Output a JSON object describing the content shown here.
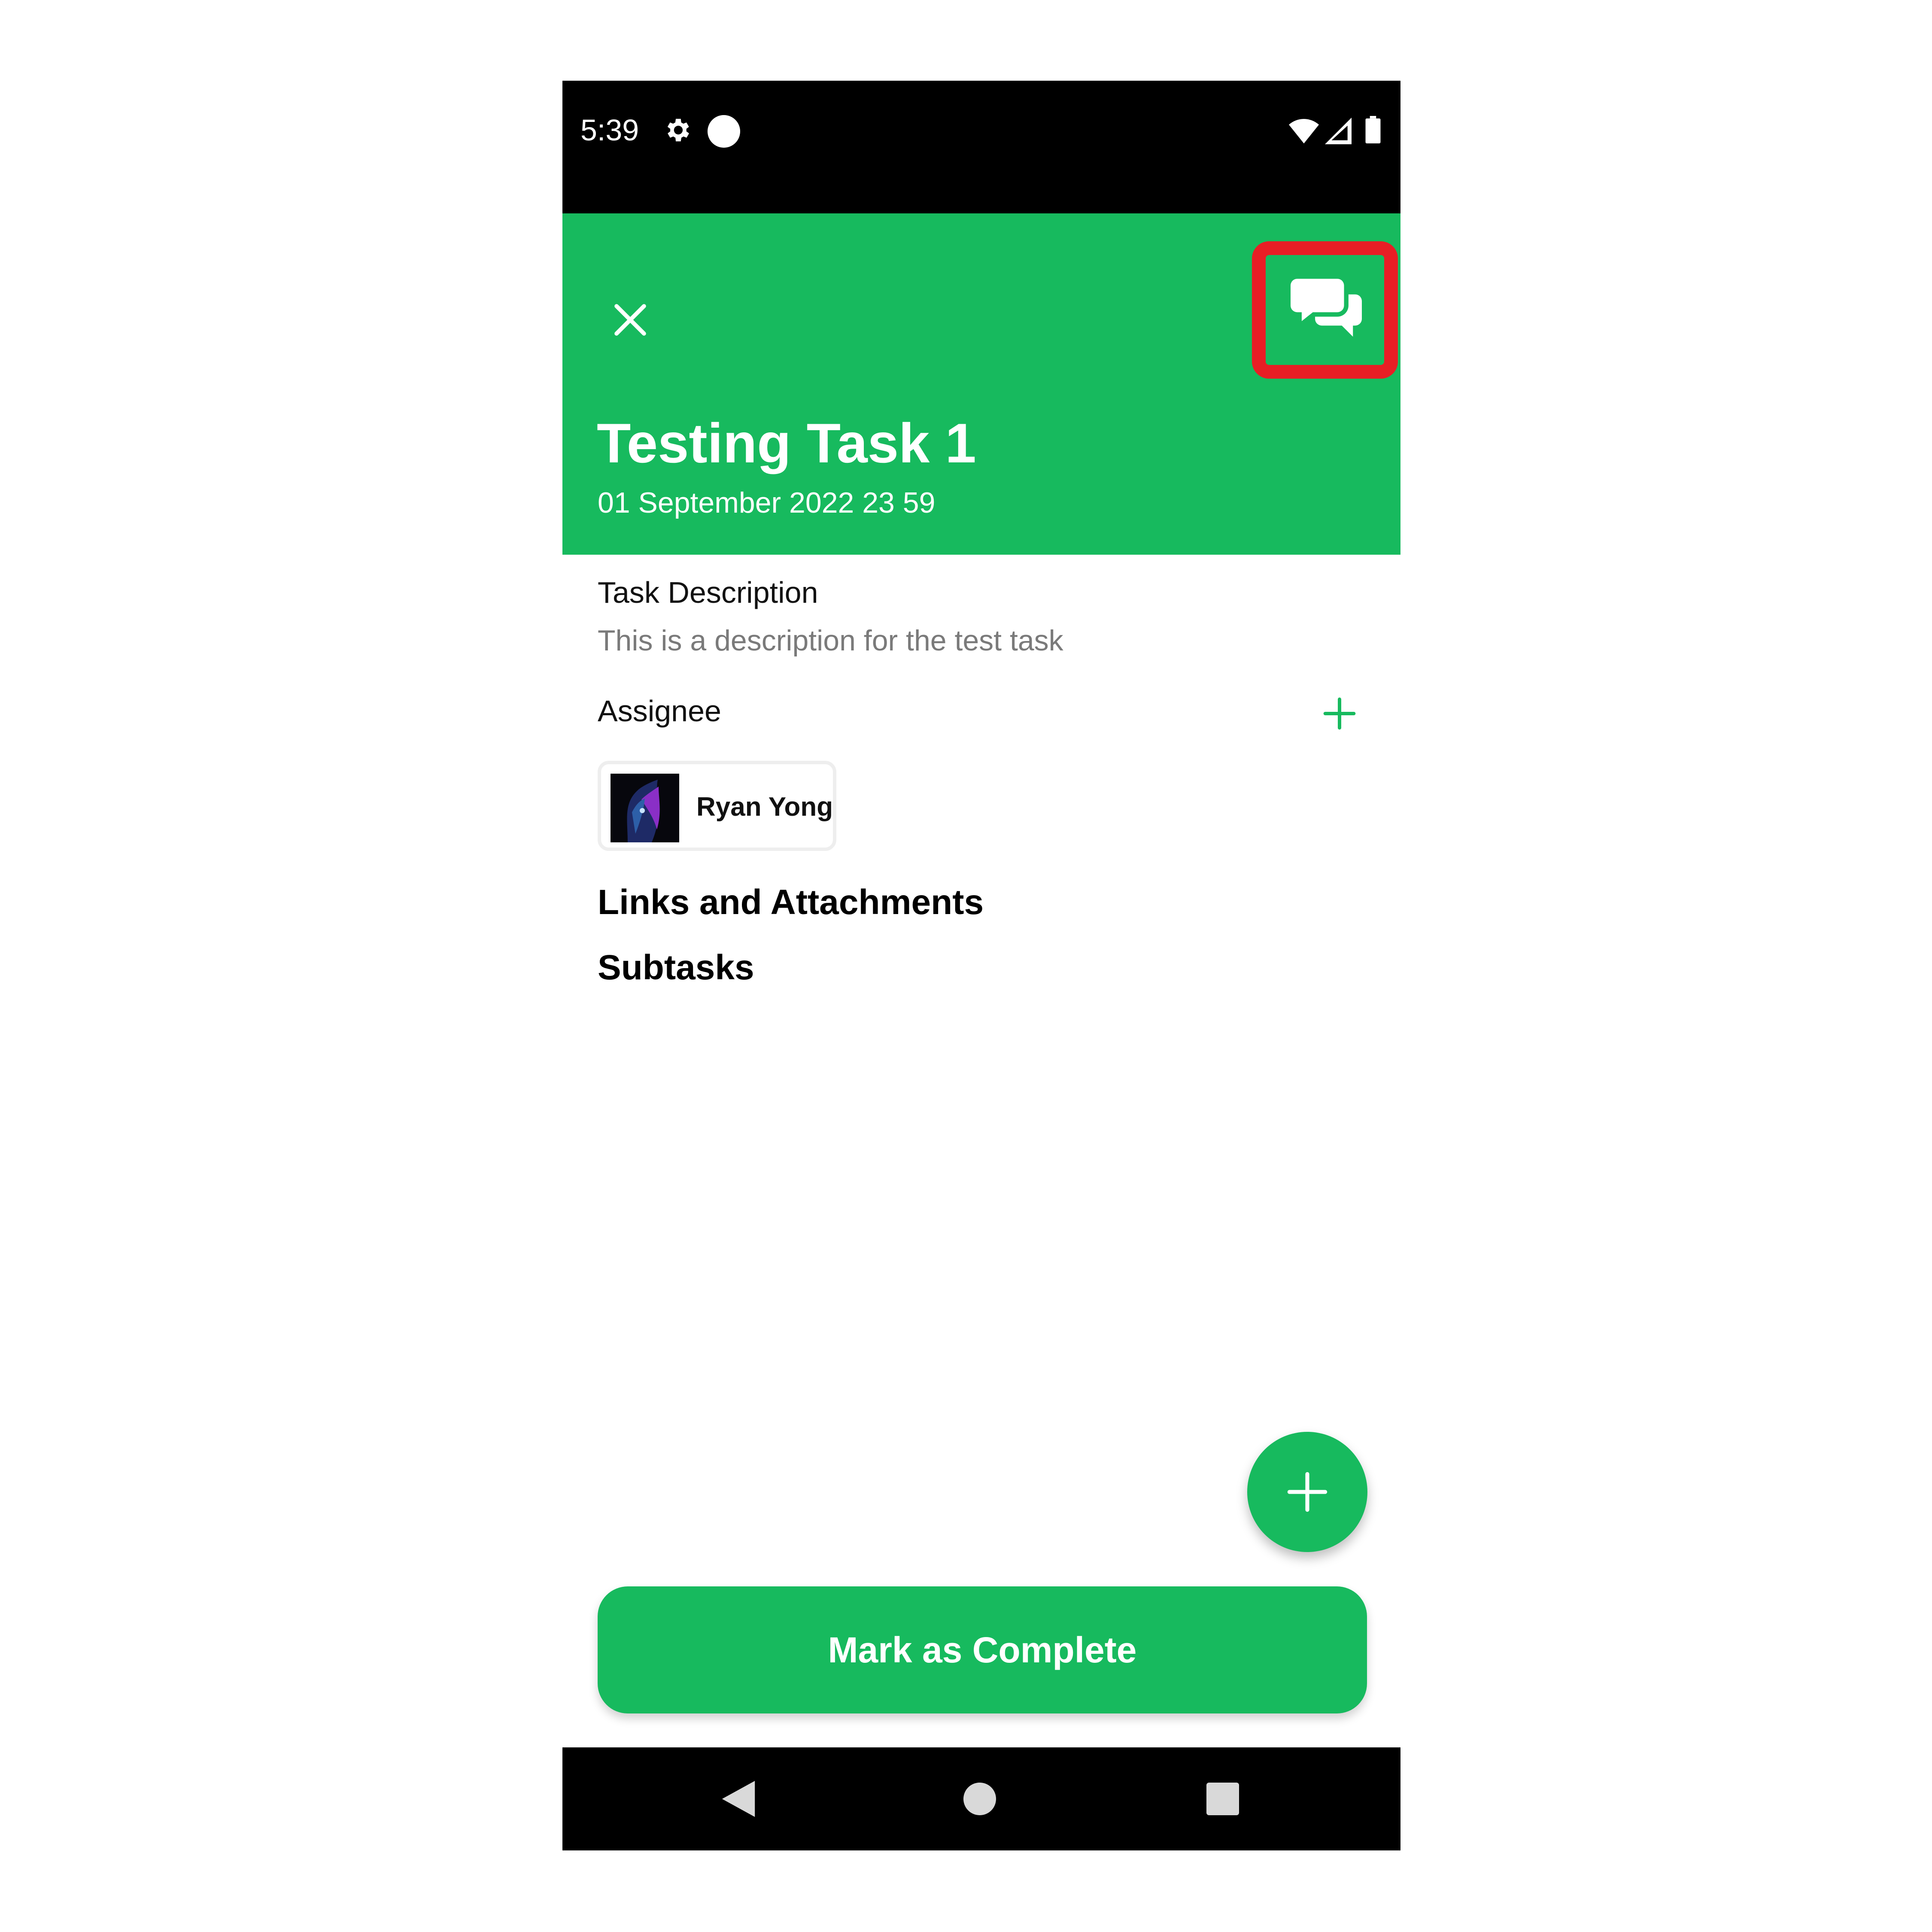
{
  "status_bar": {
    "time": "5:39"
  },
  "header": {
    "title": "Testing Task 1",
    "date": "01 September 2022 23 59"
  },
  "description": {
    "label": "Task Description",
    "text": "This is a description for the test task"
  },
  "assignee": {
    "label": "Assignee",
    "name": "Ryan Yong"
  },
  "sections": {
    "links": "Links and Attachments",
    "subtasks": "Subtasks"
  },
  "actions": {
    "complete_label": "Mark as Complete"
  },
  "colors": {
    "accent": "#17ba5e",
    "highlight": "#e81e25"
  },
  "icons": [
    "gear-icon",
    "wifi-icon",
    "signal-icon",
    "battery-icon",
    "close-icon",
    "chat-icon",
    "plus-icon",
    "back-icon",
    "home-icon",
    "recents-icon"
  ]
}
